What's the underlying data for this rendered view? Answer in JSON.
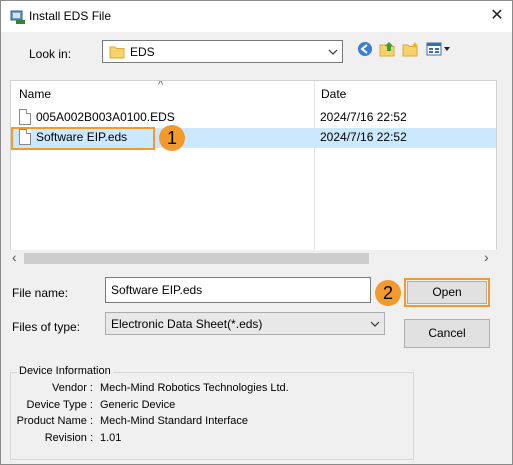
{
  "window": {
    "title": "Install EDS File",
    "close_glyph": "✕"
  },
  "look_in": {
    "label": "Look in:",
    "value": "EDS"
  },
  "columns": {
    "name": "Name",
    "date": "Date",
    "sort_glyph": "^"
  },
  "files": [
    {
      "name": "005A002B003A0100.EDS",
      "date": "2024/7/16 22:52"
    },
    {
      "name": "Software EIP.eds",
      "date": "2024/7/16 22:52"
    }
  ],
  "scroll": {
    "left": "‹",
    "right": "›"
  },
  "file_name": {
    "label": "File name:",
    "value": "Software EIP.eds"
  },
  "file_type": {
    "label": "Files of type:",
    "value": "Electronic Data Sheet(*.eds)"
  },
  "buttons": {
    "open": "Open",
    "cancel": "Cancel"
  },
  "badges": {
    "one": "1",
    "two": "2"
  },
  "device_info": {
    "title": "Device Information",
    "rows": [
      {
        "key": "Vendor :",
        "value": "Mech-Mind Robotics Technologies Ltd."
      },
      {
        "key": "Device Type :",
        "value": "Generic Device"
      },
      {
        "key": "Product Name :",
        "value": "Mech-Mind Standard Interface"
      },
      {
        "key": "Revision :",
        "value": "1.01"
      }
    ]
  },
  "colors": {
    "accent": "#f29a2e",
    "selection": "#cce8ff",
    "folder": "#f7d26b"
  }
}
